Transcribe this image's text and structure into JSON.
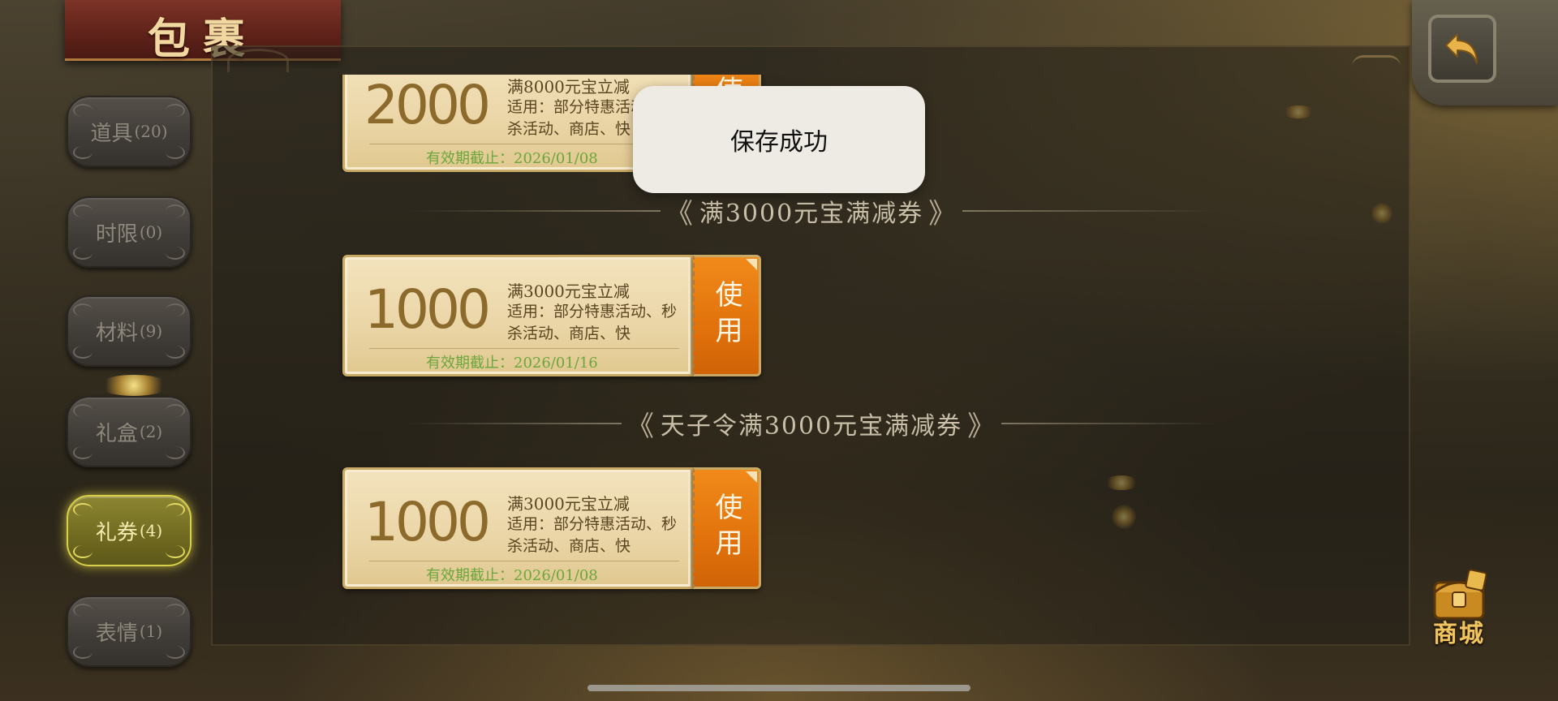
{
  "title": "包裹",
  "sidebar": {
    "items": [
      {
        "label": "道具",
        "count": "(20)"
      },
      {
        "label": "时限",
        "count": "(0)"
      },
      {
        "label": "材料",
        "count": "(9)"
      },
      {
        "label": "礼盒",
        "count": "(2)"
      },
      {
        "label": "礼券",
        "count": "(4)"
      },
      {
        "label": "表情",
        "count": "(1)"
      }
    ],
    "active_index": 4
  },
  "coupons": [
    {
      "amount": "2000",
      "title": "满8000元宝立减",
      "desc": "适用：部分特惠活动、秒杀活动、商店、快",
      "expiry": "有效期截止：2026/01/08",
      "use_label": "使用"
    },
    {
      "amount": "1000",
      "title": "满3000元宝立减",
      "desc": "适用：部分特惠活动、秒杀活动、商店、快",
      "expiry": "有效期截止：2026/01/16",
      "use_label": "使用"
    },
    {
      "amount": "1000",
      "title": "满3000元宝立减",
      "desc": "适用：部分特惠活动、秒杀活动、商店、快",
      "expiry": "有效期截止：2026/01/08",
      "use_label": "使用"
    }
  ],
  "sections": [
    {
      "title": "满3000元宝满减券"
    },
    {
      "title": "天子令满3000元宝满减券"
    }
  ],
  "toast": {
    "text": "保存成功"
  },
  "shop": {
    "label": "商城"
  },
  "icons": {
    "back": "back-arrow-icon",
    "shop": "treasure-chest-icon"
  },
  "colors": {
    "active_tab": "#d8cf4a",
    "use_button": "#e2720c",
    "expiry_text": "#6ca63c"
  }
}
